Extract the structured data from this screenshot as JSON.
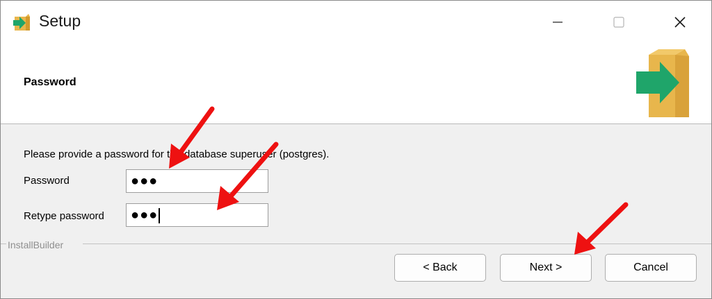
{
  "window": {
    "title": "Setup",
    "minimize_symbol": "—",
    "maximize_symbol": "☐",
    "close_symbol": "✕",
    "icon": "installer-box-arrow-icon"
  },
  "header": {
    "title": "Password",
    "logo_icon": "installer-box-arrow-icon"
  },
  "content": {
    "description": "Please provide a password for the database superuser (postgres).",
    "password_label": "Password",
    "password_value": "●●●",
    "retype_label": "Retype password",
    "retype_value": "●●●"
  },
  "footer": {
    "brand": "InstallBuilder",
    "back_label": "< Back",
    "next_label": "Next >",
    "cancel_label": "Cancel"
  },
  "colors": {
    "annotation_arrow": "#ee1111",
    "logo_box": "#e8b64c",
    "logo_arrow": "#1fa56a"
  }
}
